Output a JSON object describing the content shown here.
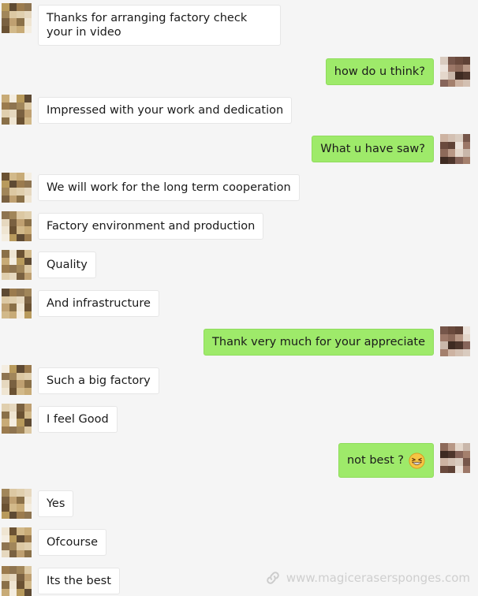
{
  "conversation": {
    "messages": [
      {
        "side": "left",
        "text": "Thanks for arranging factory check your in video"
      },
      {
        "side": "right",
        "text": "how do u think?"
      },
      {
        "side": "left",
        "text": "Impressed with your work and dedication"
      },
      {
        "side": "right",
        "text": "What u have saw?"
      },
      {
        "side": "left",
        "text": "We will work for the long term cooperation"
      },
      {
        "side": "left",
        "text": "Factory environment and production"
      },
      {
        "side": "left",
        "text": "Quality"
      },
      {
        "side": "left",
        "text": "And infrastructure"
      },
      {
        "side": "right",
        "text": "Thank very much for your appreciate"
      },
      {
        "side": "left",
        "text": "Such a big factory"
      },
      {
        "side": "left",
        "text": "I feel Good"
      },
      {
        "side": "right",
        "text": "not best  ?",
        "emoji": "grinning-face-icon"
      },
      {
        "side": "left",
        "text": "Yes"
      },
      {
        "side": "left",
        "text": "Ofcourse"
      },
      {
        "side": "left",
        "text": "Its the best"
      }
    ]
  },
  "watermark": {
    "text": "www.magicerasersponges.com",
    "icon": "link-icon"
  },
  "colors": {
    "background": "#f5f5f5",
    "incoming_bubble": "#ffffff",
    "outgoing_bubble": "#9eea6a"
  }
}
